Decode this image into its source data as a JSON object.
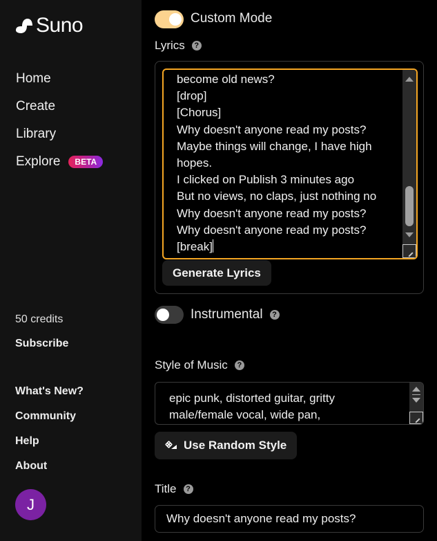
{
  "app": {
    "name": "Suno"
  },
  "sidebar": {
    "nav": [
      {
        "label": "Home"
      },
      {
        "label": "Create"
      },
      {
        "label": "Library"
      },
      {
        "label": "Explore",
        "badge": "BETA"
      }
    ],
    "credits": "50 credits",
    "subscribe": "Subscribe",
    "links": [
      {
        "label": "What's New?"
      },
      {
        "label": "Community"
      },
      {
        "label": "Help"
      },
      {
        "label": "About"
      }
    ],
    "avatar_initial": "J"
  },
  "main": {
    "custom_mode": {
      "label": "Custom Mode",
      "on": true
    },
    "lyrics": {
      "label": "Lyrics",
      "help_icon": "?",
      "visible_text": "become old news?\n[drop]\n[Chorus]\nWhy doesn't anyone read my posts?\nMaybe things will change, I have high\nhopes.\nI clicked on Publish 3 minutes ago\nBut no views, no claps, just nothing no\nWhy doesn't anyone read my posts?\nWhy doesn't anyone read my posts?\n[break]",
      "generate_button": "Generate Lyrics"
    },
    "instrumental": {
      "label": "Instrumental",
      "on": false,
      "help_icon": "?"
    },
    "style": {
      "label": "Style of Music",
      "help_icon": "?",
      "value": "epic punk, distorted guitar, gritty\nmale/female vocal, wide pan,",
      "random_button": "Use Random Style",
      "random_icon": "dice-icon"
    },
    "title": {
      "label": "Title",
      "help_icon": "?",
      "value": "Why doesn't anyone read my posts?"
    }
  },
  "colors": {
    "accent_orange": "#f5a623",
    "toggle_on": "#fcd38f",
    "beta_badge_start": "#e5235a",
    "beta_badge_end": "#8a2be2",
    "avatar": "#7b22a3"
  }
}
